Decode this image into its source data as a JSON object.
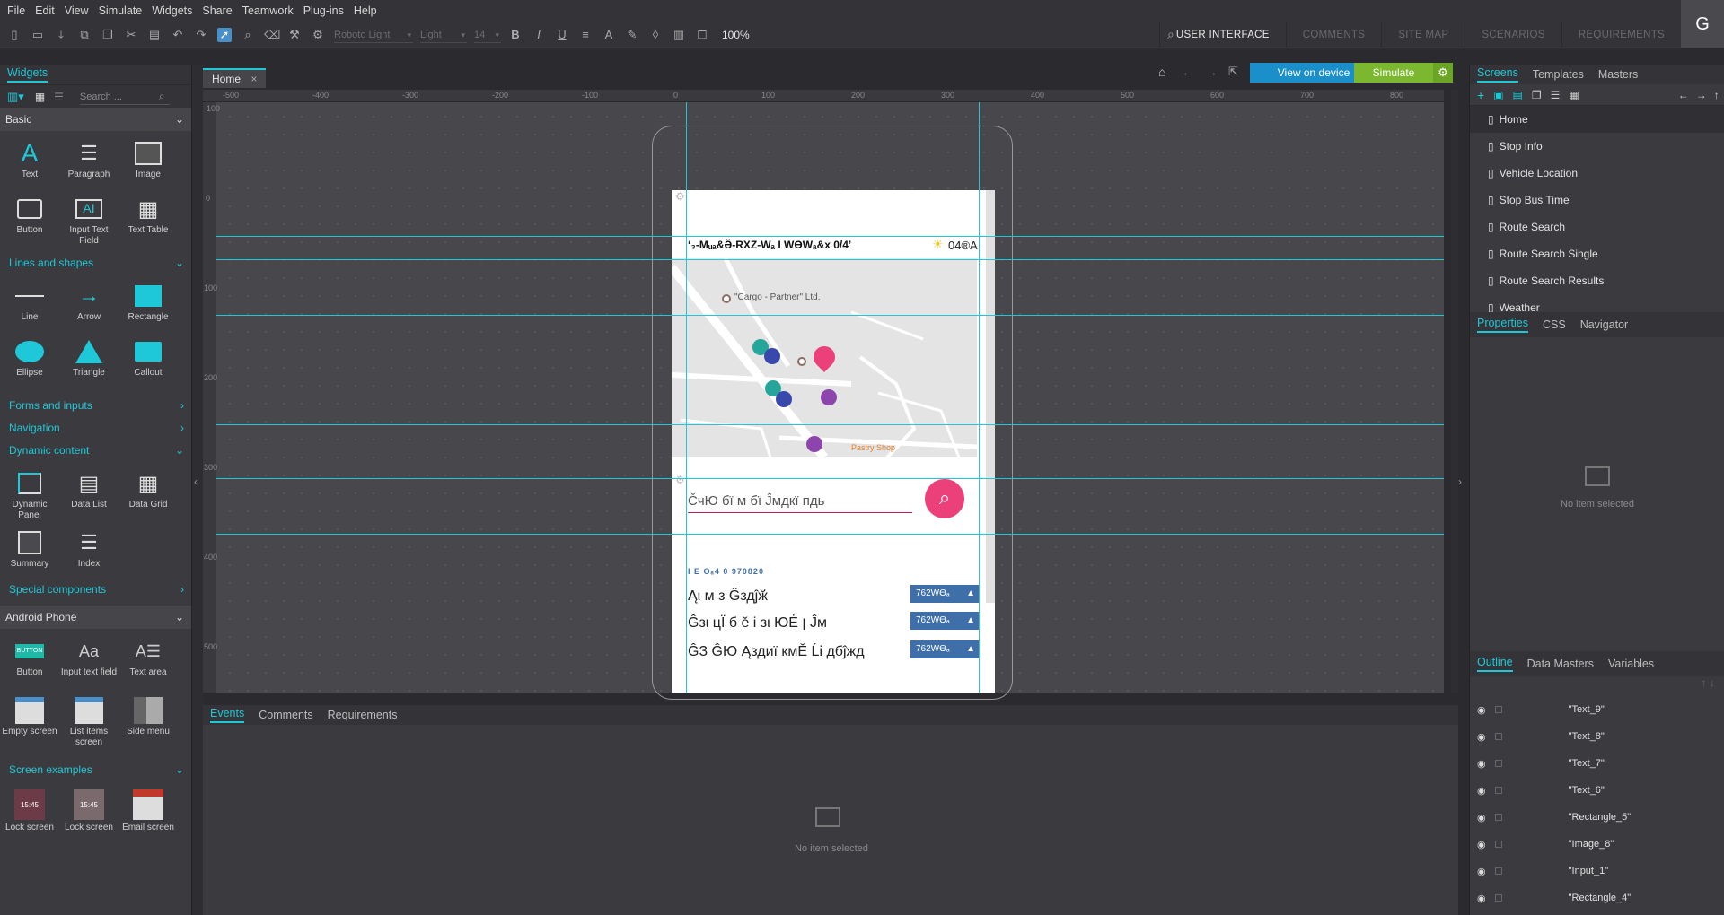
{
  "menu": [
    "File",
    "Edit",
    "View",
    "Simulate",
    "Widgets",
    "Share",
    "Teamwork",
    "Plug-ins",
    "Help"
  ],
  "toolbar": {
    "font": "Roboto Light",
    "weight": "Light",
    "size": "14",
    "zoom": "100%"
  },
  "modes": [
    "USER INTERFACE",
    "COMMENTS",
    "SITE MAP",
    "SCENARIOS",
    "REQUIREMENTS"
  ],
  "avatar": "G",
  "widgets": {
    "title": "Widgets",
    "search_placeholder": "Search ...",
    "basic": {
      "title": "Basic",
      "items": [
        "Text",
        "Paragraph",
        "Image",
        "Button",
        "Input Text Field",
        "Text Table"
      ]
    },
    "lines": {
      "title": "Lines and shapes",
      "items": [
        "Line",
        "Arrow",
        "Rectangle",
        "Ellipse",
        "Triangle",
        "Callout"
      ]
    },
    "forms": "Forms and inputs",
    "navigation": "Navigation",
    "dynamic": {
      "title": "Dynamic content",
      "items": [
        "Dynamic Panel",
        "Data List",
        "Data Grid",
        "Summary",
        "Index"
      ]
    },
    "special": "Special components",
    "android": {
      "title": "Android Phone",
      "items": [
        "Button",
        "Input text field",
        "Text area",
        "Empty screen",
        "List items screen",
        "Side menu"
      ],
      "button_text": "BUTTON"
    },
    "examples": {
      "title": "Screen examples",
      "items": [
        "Lock screen",
        "Lock screen",
        "Email screen"
      ],
      "time": "15:45"
    }
  },
  "canvas": {
    "tab": "Home",
    "view_on_device": "View on device",
    "simulate": "Simulate",
    "ruler_h": [
      "-500",
      "-400",
      "-300",
      "-200",
      "-100",
      "0",
      "100",
      "200",
      "300",
      "400",
      "500",
      "600",
      "700",
      "800"
    ],
    "ruler_v": [
      "-100",
      "0",
      "100",
      "200",
      "300",
      "400",
      "500"
    ],
    "screen": {
      "header": "ʻ₃-Mᵤₐ&Ӛ-RXZ-Wₐ I WӨWₐ&x 0/4ʼ",
      "temp": "04®A",
      "map_labels": [
        "\"Cargo - Partner\" Ltd.",
        "Pastry Shop"
      ],
      "search_text": "ČчЮ бї м  бї Ĵмдкї пдь",
      "list_header": "I E Өₐ4 0 970820",
      "rows": [
        "Ąι м з Ĝздĵӂ",
        "Ĝзι цЇ б ě і зι ЮĖ ן Ĵм",
        "ĜЗ ĜЮ Ąздиї кмĚ Ĺі дбĵжд"
      ],
      "badge": "762WӨₐ"
    }
  },
  "bottom": {
    "tabs": [
      "Events",
      "Comments",
      "Requirements"
    ],
    "empty": "No item selected"
  },
  "screens": {
    "tabs": [
      "Screens",
      "Templates",
      "Masters"
    ],
    "items": [
      "Home",
      "Stop Info",
      "Vehicle Location",
      "Stop Bus Time",
      "Route Search",
      "Route Search Single",
      "Route Search Results",
      "Weather"
    ]
  },
  "properties": {
    "tabs": [
      "Properties",
      "CSS",
      "Navigator"
    ],
    "empty": "No item selected"
  },
  "outline": {
    "tabs": [
      "Outline",
      "Data Masters",
      "Variables"
    ],
    "items": [
      "\"Text_9\"",
      "\"Text_8\"",
      "\"Text_7\"",
      "\"Text_6\"",
      "\"Rectangle_5\"",
      "\"Image_8\"",
      "\"Input_1\"",
      "\"Rectangle_4\""
    ]
  },
  "colors": {
    "accent": "#1fc8d8",
    "simulate": "#7cb82f",
    "device_btn": "#1a8fc9",
    "pin": "#ec407a",
    "badge": "#3f6fa8"
  }
}
